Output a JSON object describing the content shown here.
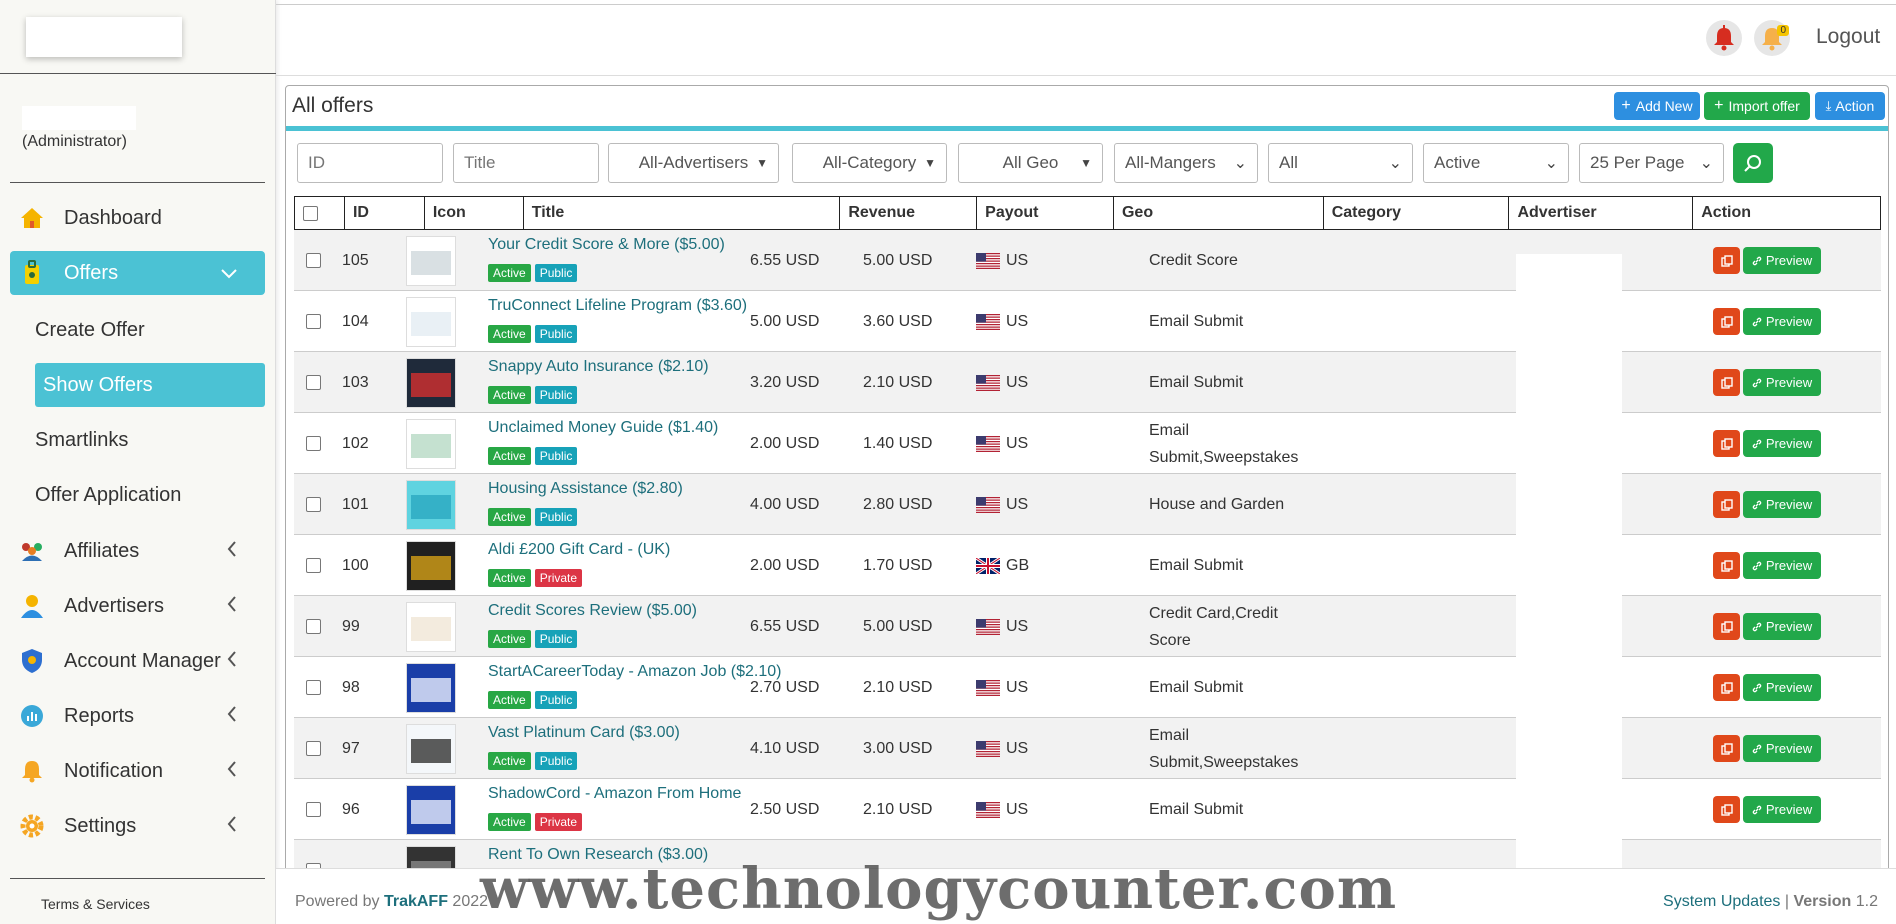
{
  "sidebar": {
    "user_role": "(Administrator)",
    "nav": [
      {
        "label": "Dashboard",
        "icon": "home-icon"
      },
      {
        "label": "Offers",
        "icon": "offers-icon"
      },
      {
        "label": "Affiliates",
        "icon": "affiliates-icon"
      },
      {
        "label": "Advertisers",
        "icon": "user-icon"
      },
      {
        "label": "Account Manager",
        "icon": "shield-icon"
      },
      {
        "label": "Reports",
        "icon": "chart-icon"
      },
      {
        "label": "Notification",
        "icon": "bell-icon"
      },
      {
        "label": "Settings",
        "icon": "gear-icon"
      }
    ],
    "sub": [
      "Create Offer",
      "Show Offers",
      "Smartlinks",
      "Offer Application"
    ],
    "terms": "Terms & Services"
  },
  "header": {
    "notif_count": "0",
    "logout": "Logout"
  },
  "panel": {
    "title": "All offers",
    "add_new": "Add New",
    "import_offer": "Import offer",
    "action": "Action"
  },
  "filters": {
    "id_placeholder": "ID",
    "title_placeholder": "Title",
    "advertisers": "All-Advertisers",
    "category": "All-Category",
    "geo": "All Geo",
    "managers": "All-Mangers",
    "all": "All",
    "status": "Active",
    "per_page": "25 Per Page"
  },
  "table": {
    "columns": [
      "ID",
      "Icon",
      "Title",
      "Revenue",
      "Payout",
      "Geo",
      "Category",
      "Advertiser",
      "Action"
    ],
    "preview_label": "Preview",
    "rows": [
      {
        "id": "105",
        "title": "Your Credit Score & More ($5.00)",
        "status": "Active",
        "visibility": "Public",
        "revenue": "6.55 USD",
        "payout": "5.00 USD",
        "geo": "US",
        "category": "Credit Score"
      },
      {
        "id": "104",
        "title": "TruConnect Lifeline Program ($3.60)",
        "status": "Active",
        "visibility": "Public",
        "revenue": "5.00 USD",
        "payout": "3.60 USD",
        "geo": "US",
        "category": "Email Submit"
      },
      {
        "id": "103",
        "title": "Snappy Auto Insurance ($2.10)",
        "status": "Active",
        "visibility": "Public",
        "revenue": "3.20 USD",
        "payout": "2.10 USD",
        "geo": "US",
        "category": "Email Submit"
      },
      {
        "id": "102",
        "title": "Unclaimed Money Guide ($1.40)",
        "status": "Active",
        "visibility": "Public",
        "revenue": "2.00 USD",
        "payout": "1.40 USD",
        "geo": "US",
        "category": "Email Submit,Sweepstakes"
      },
      {
        "id": "101",
        "title": "Housing Assistance ($2.80)",
        "status": "Active",
        "visibility": "Public",
        "revenue": "4.00 USD",
        "payout": "2.80 USD",
        "geo": "US",
        "category": "House and Garden"
      },
      {
        "id": "100",
        "title": "Aldi £200 Gift Card - (UK)",
        "status": "Active",
        "visibility": "Private",
        "revenue": "2.00 USD",
        "payout": "1.70 USD",
        "geo": "GB",
        "category": "Email Submit"
      },
      {
        "id": "99",
        "title": "Credit Scores Review ($5.00)",
        "status": "Active",
        "visibility": "Public",
        "revenue": "6.55 USD",
        "payout": "5.00 USD",
        "geo": "US",
        "category": "Credit Card,Credit Score"
      },
      {
        "id": "98",
        "title": "StartACareerToday - Amazon Job ($2.10)",
        "status": "Active",
        "visibility": "Public",
        "revenue": "2.70 USD",
        "payout": "2.10 USD",
        "geo": "US",
        "category": "Email Submit"
      },
      {
        "id": "97",
        "title": "Vast Platinum Card ($3.00)",
        "status": "Active",
        "visibility": "Public",
        "revenue": "4.10 USD",
        "payout": "3.00 USD",
        "geo": "US",
        "category": "Email Submit,Sweepstakes"
      },
      {
        "id": "96",
        "title": "ShadowCord - Amazon From Home",
        "status": "Active",
        "visibility": "Private",
        "revenue": "2.50 USD",
        "payout": "2.10 USD",
        "geo": "US",
        "category": "Email Submit"
      },
      {
        "id": "",
        "title": "Rent To Own Research ($3.00)",
        "status": "",
        "visibility": "",
        "revenue": "",
        "payout": "",
        "geo": "",
        "category": ""
      }
    ]
  },
  "footer": {
    "powered_prefix": "Powered by",
    "brand": "TrakAFF",
    "year": "2022",
    "system_updates": "System Updates",
    "separator": "|",
    "version_label": "Version",
    "version": "1.2"
  },
  "watermark": "www.technologycounter.com"
}
